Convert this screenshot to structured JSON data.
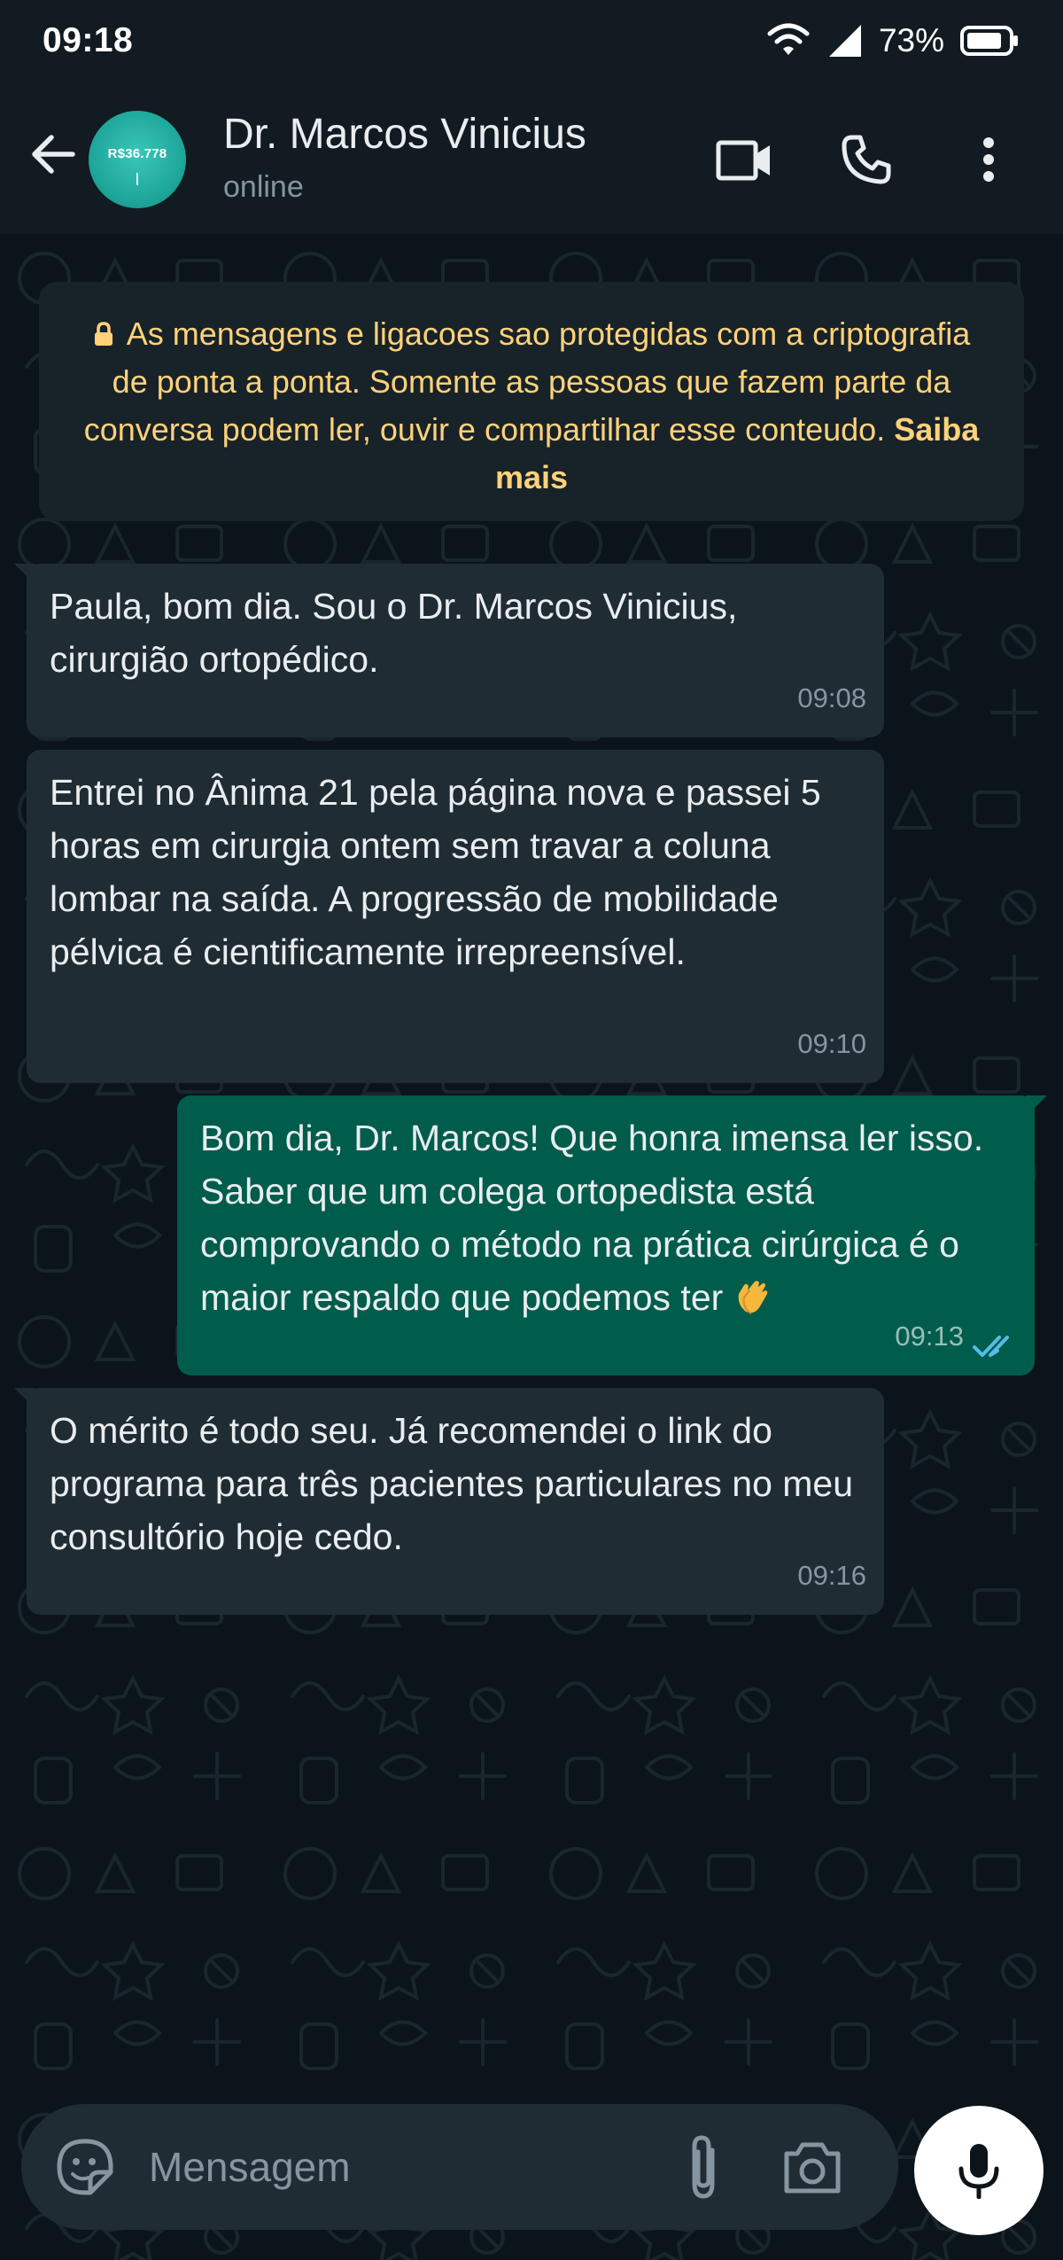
{
  "status_bar": {
    "time": "09:18",
    "battery_percent": "73%",
    "icons": [
      "wifi-icon",
      "signal-icon",
      "battery-icon"
    ]
  },
  "header": {
    "contact_name": "Dr. Marcos Vinicius",
    "contact_status": "online",
    "avatar_text": "R$36.778",
    "icons": [
      "back-arrow-icon",
      "video-call-icon",
      "voice-call-icon",
      "more-options-icon"
    ]
  },
  "encryption_notice": {
    "text": "As mensagens e ligacoes sao protegidas com a criptografia de ponta a ponta. Somente as pessoas que fazem parte da conversa podem ler, ouvir e compartilhar esse conteudo.",
    "link": "Saiba mais"
  },
  "messages": [
    {
      "direction": "incoming",
      "text": "Paula, bom dia. Sou o Dr. Marcos Vinicius, cirurgião ortopédico.",
      "time": "09:08"
    },
    {
      "direction": "incoming",
      "text": "Entrei no Ânima 21 pela página nova e passei 5 horas em cirurgia ontem sem travar a coluna lombar na saída. A progressão de mobilidade pélvica é cientificamente irrepreensível.",
      "time": "09:10"
    },
    {
      "direction": "outgoing",
      "text": "Bom dia, Dr. Marcos! Que honra imensa ler isso. Saber que um colega ortopedista está comprovando o método na prática cirúrgica é o maior respaldo que podemos ter",
      "emoji": "clapping-hands-emoji",
      "time": "09:13",
      "status": "read"
    },
    {
      "direction": "incoming",
      "text": "O mérito é todo seu. Já recomendei o link do programa para três pacientes particulares no meu consultório hoje cedo.",
      "time": "09:16"
    }
  ],
  "composer": {
    "placeholder": "Mensagem",
    "value": "",
    "icons": [
      "sticker-icon",
      "attach-icon",
      "camera-icon",
      "mic-icon"
    ]
  },
  "colors": {
    "background": "#0b141a",
    "header": "#121b22",
    "incoming_bubble": "#202c33",
    "outgoing_bubble": "#005c4b",
    "notice_text": "#ffd279",
    "read_ticks": "#53bdeb"
  }
}
